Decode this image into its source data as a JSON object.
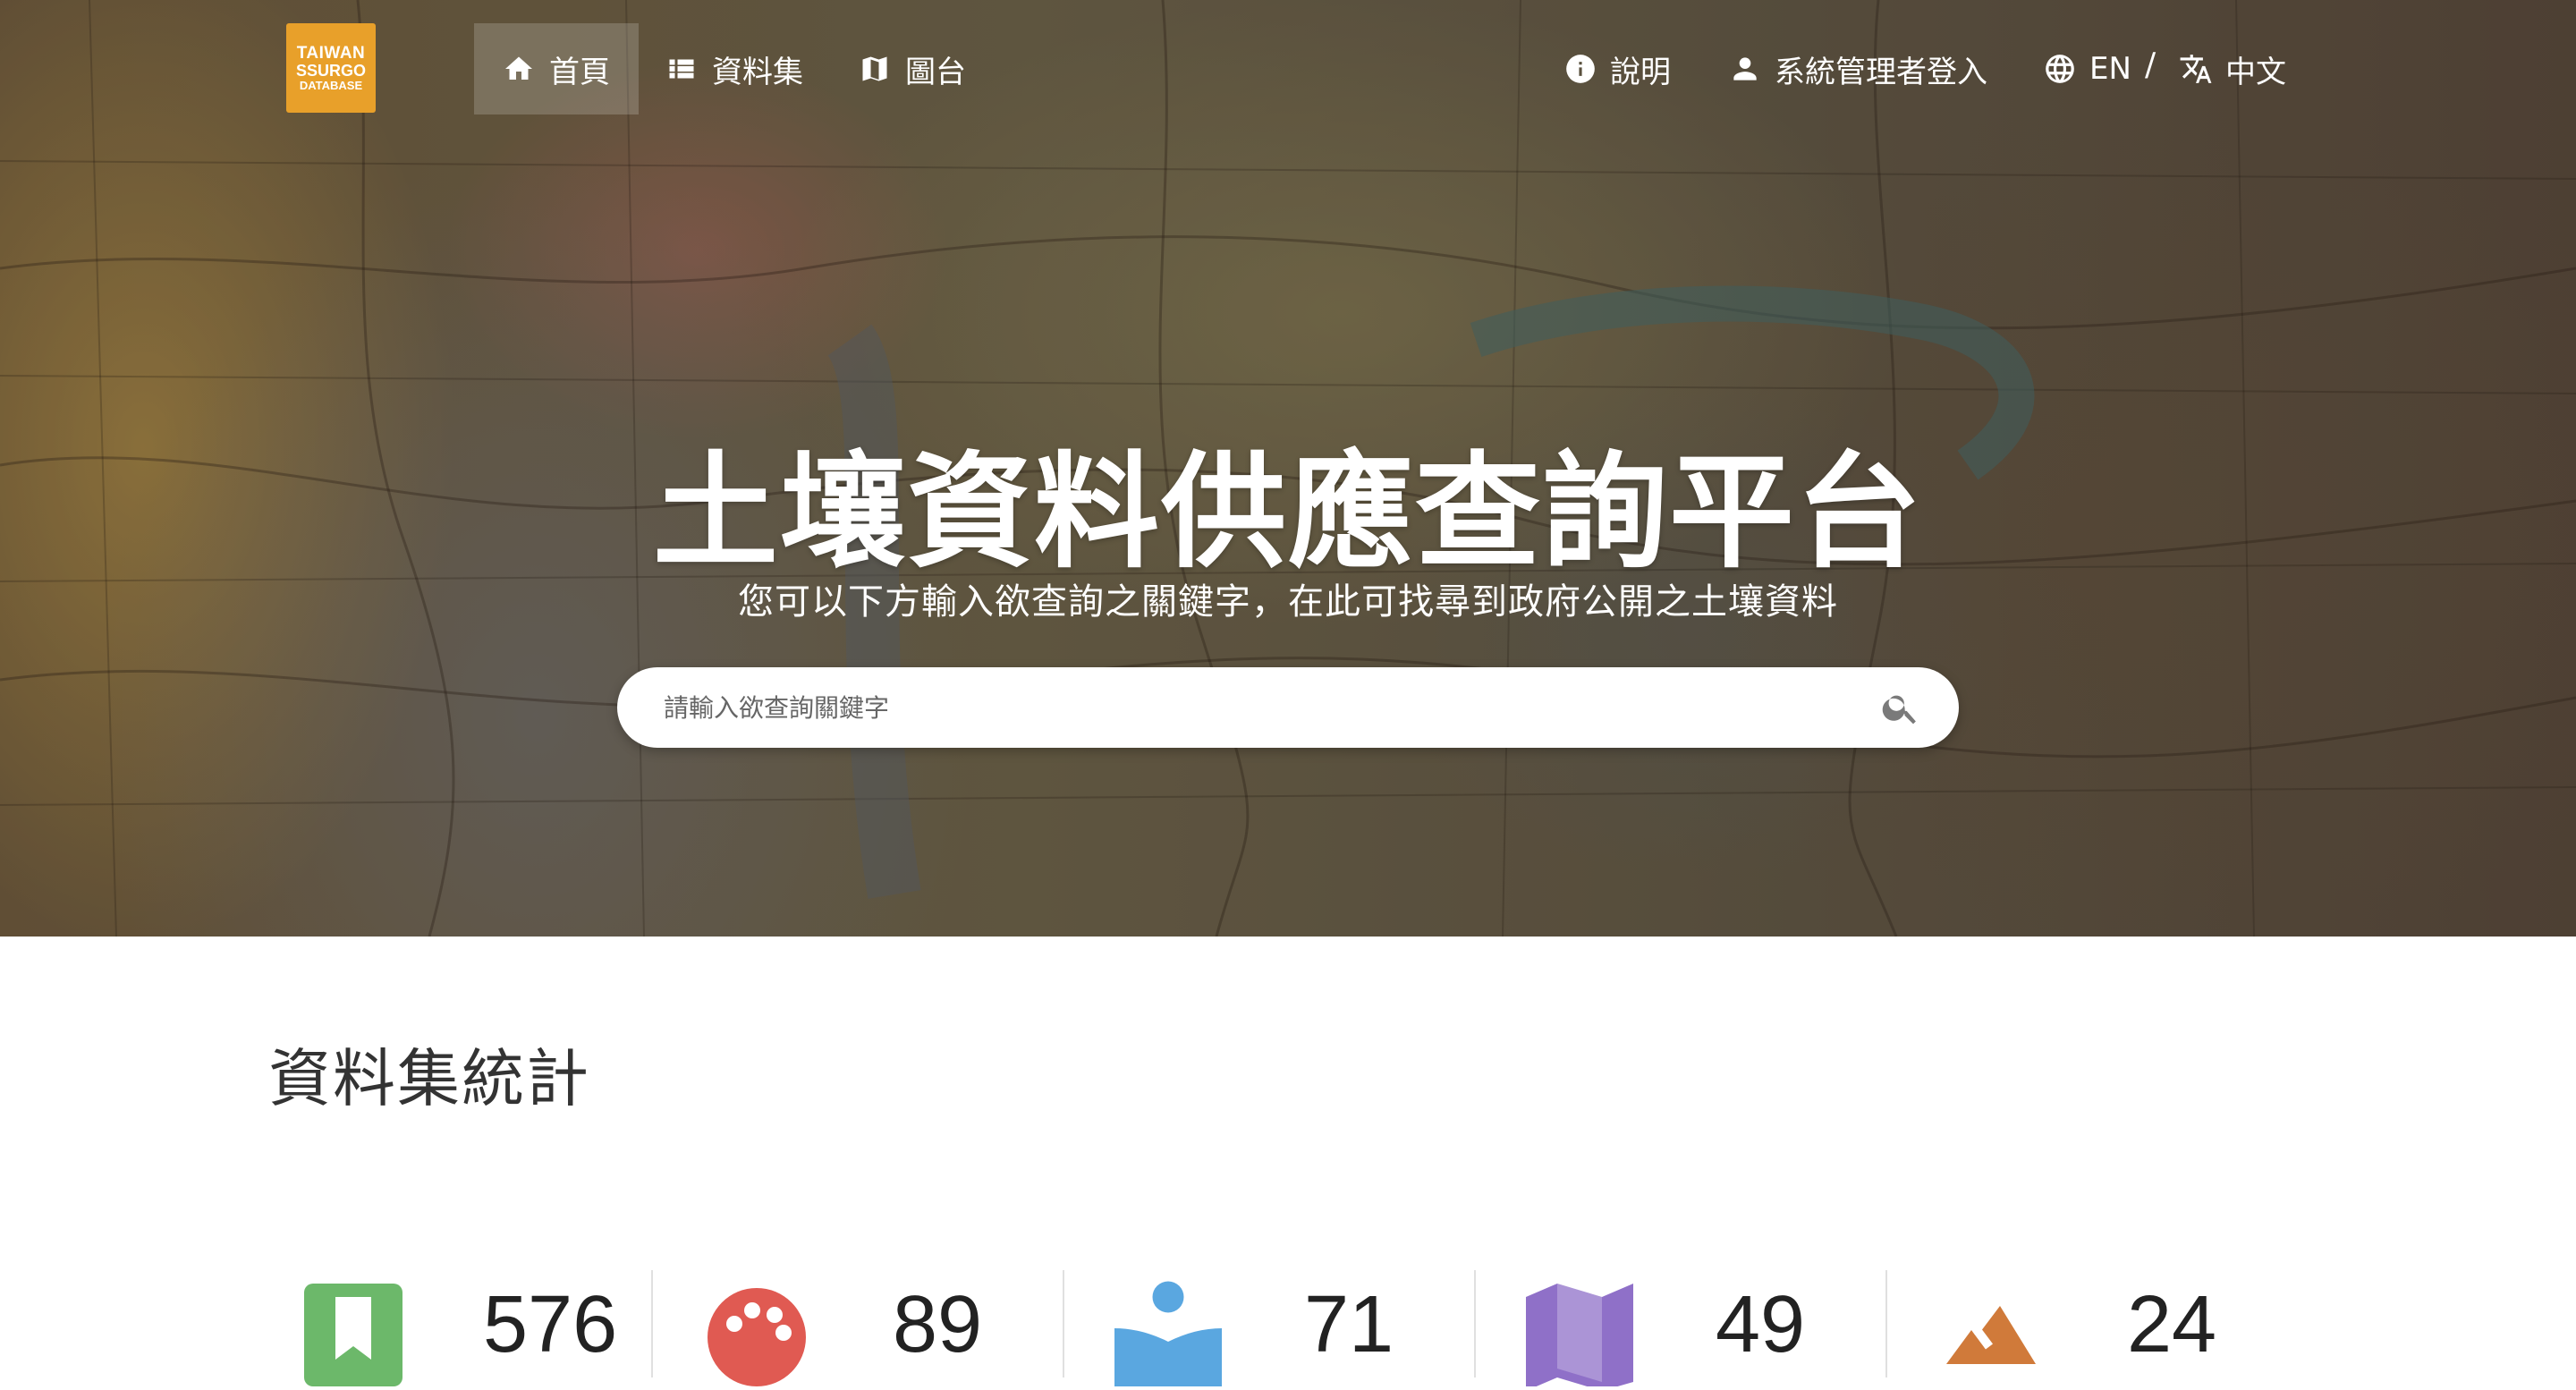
{
  "logo": {
    "line1": "TAIWAN",
    "line2": "SSURGO",
    "line3": "DATABASE"
  },
  "nav": {
    "home": "首頁",
    "datasets": "資料集",
    "maps": "圖台",
    "help": "說明",
    "admin_login": "系統管理者登入",
    "lang_en": "EN",
    "lang_separator": "/",
    "lang_zh": "中文"
  },
  "hero": {
    "title": "土壤資料供應查詢平台",
    "subtitle": "您可以下方輸入欲查詢之關鍵字，在此可找尋到政府公開之土壤資料",
    "search_placeholder": "請輸入欲查詢關鍵字"
  },
  "stats": {
    "title": "資料集統計",
    "items": [
      {
        "icon": "bookmark-icon",
        "color": "#6cb86a",
        "value": "576"
      },
      {
        "icon": "palette-icon",
        "color": "#e05a52",
        "value": "89"
      },
      {
        "icon": "reader-icon",
        "color": "#5aa7e0",
        "value": "71"
      },
      {
        "icon": "map-icon",
        "color": "#8f70c8",
        "value": "49"
      },
      {
        "icon": "terrain-icon",
        "color": "#d07a3a",
        "value": "24"
      }
    ]
  }
}
